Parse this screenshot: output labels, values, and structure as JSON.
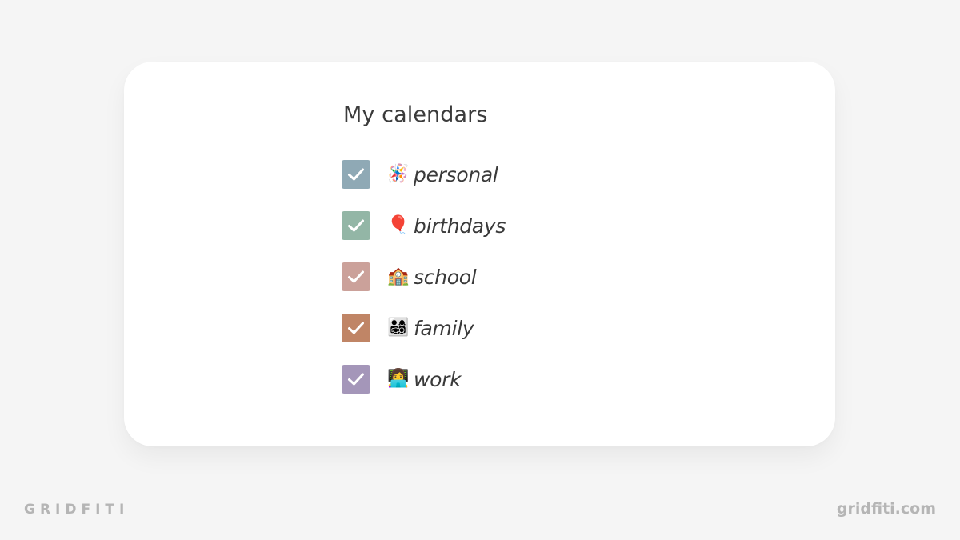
{
  "panel": {
    "title": "My calendars",
    "calendars": [
      {
        "label": "personal",
        "emoji": "🪅",
        "emoji_name": "pinata-icon",
        "checked": true,
        "color": "#8fa9b5"
      },
      {
        "label": "birthdays",
        "emoji": "🎈",
        "emoji_name": "balloon-icon",
        "checked": true,
        "color": "#93b6a6"
      },
      {
        "label": "school",
        "emoji": "🏫",
        "emoji_name": "school-icon",
        "checked": true,
        "color": "#cba19a"
      },
      {
        "label": "family",
        "emoji": "👨‍👩‍👧‍👦",
        "emoji_name": "family-icon",
        "checked": true,
        "color": "#c08566"
      },
      {
        "label": "work",
        "emoji": "👩‍💻",
        "emoji_name": "technologist-icon",
        "checked": true,
        "color": "#a496b9"
      }
    ]
  },
  "footer": {
    "brand_left": "GRIDFITI",
    "brand_right": "gridfiti.com"
  }
}
